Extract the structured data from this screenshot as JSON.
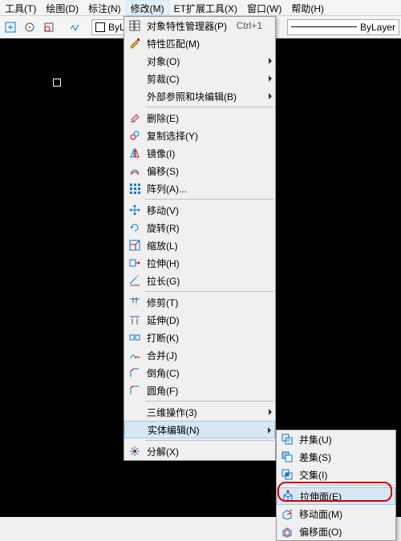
{
  "menubar": {
    "items": [
      "工具(T)",
      "绘图(D)",
      "标注(N)",
      "修改(M)",
      "ET扩展工具(X)",
      "窗口(W)",
      "帮助(H)"
    ],
    "open_index": 3
  },
  "toolbar": {
    "bylayer_label": "ByLayer",
    "bylayer_line_label": "ByLayer"
  },
  "modify_menu": [
    {
      "type": "item",
      "icon": "properties-icon",
      "label": "对象特性管理器(P)",
      "shortcut": "Ctrl+1"
    },
    {
      "type": "item",
      "icon": "match-icon",
      "label": "特性匹配(M)"
    },
    {
      "type": "item",
      "icon": null,
      "label": "对象(O)",
      "submenu": true
    },
    {
      "type": "item",
      "icon": null,
      "label": "剪裁(C)",
      "submenu": true
    },
    {
      "type": "item",
      "icon": null,
      "label": "外部参照和块编辑(B)",
      "submenu": true
    },
    {
      "type": "sep"
    },
    {
      "type": "item",
      "icon": "erase-icon",
      "label": "删除(E)"
    },
    {
      "type": "item",
      "icon": "copy-icon",
      "label": "复制选择(Y)"
    },
    {
      "type": "item",
      "icon": "mirror-icon",
      "label": "镜像(I)"
    },
    {
      "type": "item",
      "icon": "offset-icon",
      "label": "偏移(S)"
    },
    {
      "type": "item",
      "icon": "array-icon",
      "label": "阵列(A)..."
    },
    {
      "type": "sep"
    },
    {
      "type": "item",
      "icon": "move-icon",
      "label": "移动(V)"
    },
    {
      "type": "item",
      "icon": "rotate-icon",
      "label": "旋转(R)"
    },
    {
      "type": "item",
      "icon": "scale-icon",
      "label": "缩放(L)"
    },
    {
      "type": "item",
      "icon": "stretch-icon",
      "label": "拉伸(H)"
    },
    {
      "type": "item",
      "icon": "lengthen-icon",
      "label": "拉长(G)"
    },
    {
      "type": "sep"
    },
    {
      "type": "item",
      "icon": "trim-icon",
      "label": "修剪(T)"
    },
    {
      "type": "item",
      "icon": "extend-icon",
      "label": "延伸(D)"
    },
    {
      "type": "item",
      "icon": "break-icon",
      "label": "打断(K)"
    },
    {
      "type": "item",
      "icon": "join-icon",
      "label": "合并(J)"
    },
    {
      "type": "item",
      "icon": "chamfer-icon",
      "label": "倒角(C)"
    },
    {
      "type": "item",
      "icon": "fillet-icon",
      "label": "圆角(F)"
    },
    {
      "type": "sep"
    },
    {
      "type": "item",
      "icon": null,
      "label": "三维操作(3)",
      "submenu": true
    },
    {
      "type": "item",
      "icon": null,
      "label": "实体编辑(N)",
      "submenu": true,
      "highlight": true
    },
    {
      "type": "sep"
    },
    {
      "type": "item",
      "icon": "explode-icon",
      "label": "分解(X)"
    }
  ],
  "solid_edit_submenu": [
    {
      "icon": "union-icon",
      "label": "并集(U)"
    },
    {
      "icon": "subtract-icon",
      "label": "差集(S)"
    },
    {
      "icon": "intersect-icon",
      "label": "交集(I)"
    },
    {
      "icon": "extrude-face-icon",
      "label": "拉伸面(E)",
      "highlight": true
    },
    {
      "icon": "move-face-icon",
      "label": "移动面(M)"
    },
    {
      "icon": "offset-face-icon",
      "label": "偏移面(O)"
    }
  ],
  "sep_after_submenu": [
    2
  ]
}
